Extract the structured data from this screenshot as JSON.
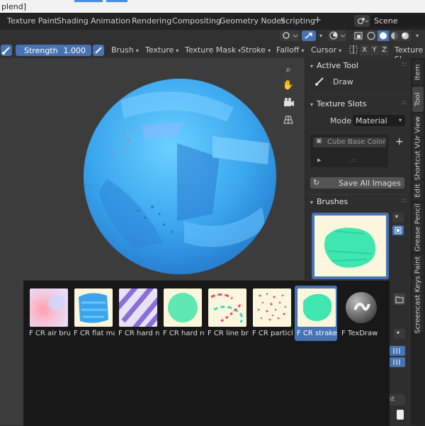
{
  "titlebar": {
    "text": "plend]"
  },
  "workspaces": [
    "Texture Paint",
    "Shading",
    "Animation",
    "Rendering",
    "Compositing",
    "Geometry Nodes",
    "Scripting"
  ],
  "scene": {
    "label": "Scene"
  },
  "tool_header": {
    "strength_label": "Strength",
    "strength_value": "1.000",
    "menus": [
      "Brush",
      "Texture",
      "Texture Mask",
      "Stroke",
      "Falloff",
      "Cursor"
    ],
    "axes": [
      "X",
      "Y",
      "Z"
    ],
    "texture_slots_btn": "Texture Sl"
  },
  "side_panel": {
    "active_tool_title": "Active Tool",
    "tool_name": "Draw",
    "texture_slots_title": "Texture Slots",
    "mode_label": "Mode",
    "mode_value": "Material",
    "slot_item": "Cube Base Color",
    "save_all_images": "Save All Images",
    "brushes_title": "Brushes",
    "partial_text": "nt"
  },
  "vertical_tabs": [
    "Item",
    "Tool",
    "View",
    "Shortcut VUr",
    "Edit",
    "Grease Pencil",
    "Paint",
    "Screencast Keys"
  ],
  "brushes": [
    {
      "label": "F CR air brush",
      "thumb": "airbrush"
    },
    {
      "label": "F CR flat mar...",
      "thumb": "flat"
    },
    {
      "label": "F CR hard n ...",
      "thumb": "stripes"
    },
    {
      "label": "F CR hard ro...",
      "thumb": "round"
    },
    {
      "label": "F CR line bre...",
      "thumb": "line"
    },
    {
      "label": "F CR particles",
      "thumb": "particles"
    },
    {
      "label": "F CR strake",
      "thumb": "strake",
      "selected": true
    },
    {
      "label": "F TexDraw",
      "thumb": "texdraw"
    }
  ],
  "colors": {
    "accent": "#4772b3",
    "viewport": "#3c3c3c",
    "sphere": "#3ba4ec",
    "mint": "#3fe6b0"
  }
}
